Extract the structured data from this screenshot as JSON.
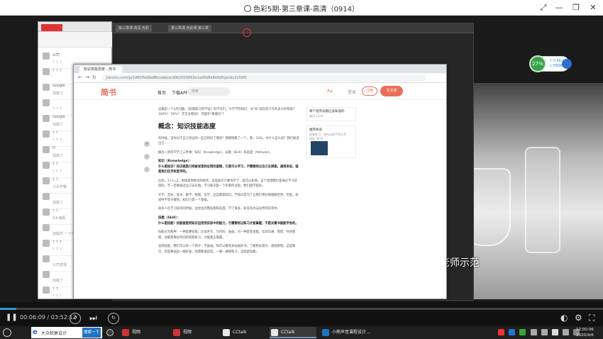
{
  "player": {
    "title": "色彩5期-第三章课-高清（0914）",
    "time_current": "00:06:09",
    "time_separator": "/",
    "time_total": "03:52:12",
    "progress": 0.0265
  },
  "widget": {
    "percent": "27%",
    "up_speed": "↑ 0.4K/s",
    "down_speed": "↓ 550K/s"
  },
  "left_app": {
    "rows": [
      {
        "label": "公司",
        "sub": "？？？"
      },
      {
        "label": "？？？",
        "sub": ""
      },
      {
        "label": "Google",
        "sub": "加载了"
      },
      {
        "label": "",
        "sub": "？？？"
      },
      {
        "label": "Google",
        "sub": "加载了"
      },
      {
        "label": "？？",
        "sub": "？？？"
      },
      {
        "label": "D",
        "sub": "加载了"
      },
      {
        "label": "？？",
        "sub": "？？？"
      },
      {
        "label": "？？",
        "sub": "小大学霸"
      },
      {
        "label": "",
        "sub": "加载了"
      },
      {
        "label": "？？",
        "sub": "X大海报"
      },
      {
        "label": "",
        "sub": "加载的 一个分数"
      },
      {
        "label": "？？？",
        "sub": "？？？"
      },
      {
        "label": "",
        "sub": "公司发展"
      },
      {
        "label": "",
        "sub": "加载了"
      },
      {
        "label": "？？",
        "sub": "？？？"
      }
    ]
  },
  "dark_app": {
    "tab1": "第三章课 高清 色彩",
    "tab2": "第三章课 色彩课 第三章"
  },
  "video_caption": "老师示范",
  "browser": {
    "tab": "知识技能态度 - 简书",
    "url": "jianshu.com/p/1480f5e6bd8bcode/xcd0b2026893e1ad5b8e8e0d5ypcbc2c5df5",
    "brand": "简书",
    "nav_home": "首页",
    "nav_app": "下载APP",
    "search_placeholder": "搜索",
    "aa": "Aa",
    "login": "登录",
    "register": "注册",
    "write": "写文章"
  },
  "article": {
    "intro": "这篇是一个3月问题。《刻意练习的学徒》的学员们。大学学的知识，对“你”现在的工作有多大的帮助？ 100%？ 50%？ 完全没帮助？ 可能有“看看吗”？",
    "heading": "概念：知识技能态度",
    "p1": "有时候，当你对于自己身边的一些已经好了哪里？我刚刚看了一个，我，10%。为什么这么说？我们知道自己……",
    "p2": "概念一步的学学上三件事：知识（Knowledge），技能（Skill）和态度（Attitude）。",
    "h_knowledge": "知识（Knowledge）：",
    "p3": "什么是知识？知识就是已经被发现和证明的道理，它是可以学习，不需要经过自己去探索。通常来说，就是我们在学校里学的。",
    "p4": "比如，1+1=2，地球是围绕太阳转的，这些知识只要你学了，就可以知道。这个道理我们是通过学习获得的，不一定要通过自己去实践。学习知识是一个积累的过程，我们越学越多。",
    "p5": "文学、音乐、美术、数学、物理、化学，这些都是知识。学知识是为了让我们更好地理解世界，但是，知道并不等于做到，知识只是一个基础。",
    "p6": "很多人在学习知识的时候，往往会忽略技能和态度。学了很多，却没有办法运用到实际中。",
    "h_skill": "技能（Skill）：",
    "p7": "什么是技能？技能就是把知识运用到实际中的能力，它需要经过练习才能掌握，不是光看书就能学会的。",
    "p8": "技能分为两种：一种是硬技能，比如开车、写代码、画画；另一种是软技能，比如沟通、管理、时间管理。技能需要长时间的刻意练习，才能真正掌握。",
    "p9": "说到技能，我们可以举一个例子：学画画。你可以看很多画画的书，了解色彩理论、透视原理，这是知识。但是要画出一幅好画，你需要拿起笔，一遍一遍地练习，这就是技能。"
  },
  "right_side": {
    "card1_title": "每个程序员都应该知道的",
    "card1_sub": "阅读 1234",
    "card2_title": "推荐阅读",
    "card2_line1": "刻意练习：如何从新手到大师",
    "card2_line2": "阅读 5678"
  },
  "taskbar": {
    "ie_label": "大众检察设计",
    "search_btn": "搜索一下",
    "items": [
      {
        "label": "视频",
        "color": "#c33"
      },
      {
        "label": "视频",
        "color": "#c33"
      },
      {
        "label": "CCtalk",
        "color": "#e8e8e8"
      },
      {
        "label": "CCtalk",
        "color": "#e8e8e8"
      },
      {
        "label": "小熊声音课程设计…",
        "color": "#1e73be"
      }
    ],
    "clock_time": "12:00:06",
    "clock_date": "2020/4/6"
  }
}
